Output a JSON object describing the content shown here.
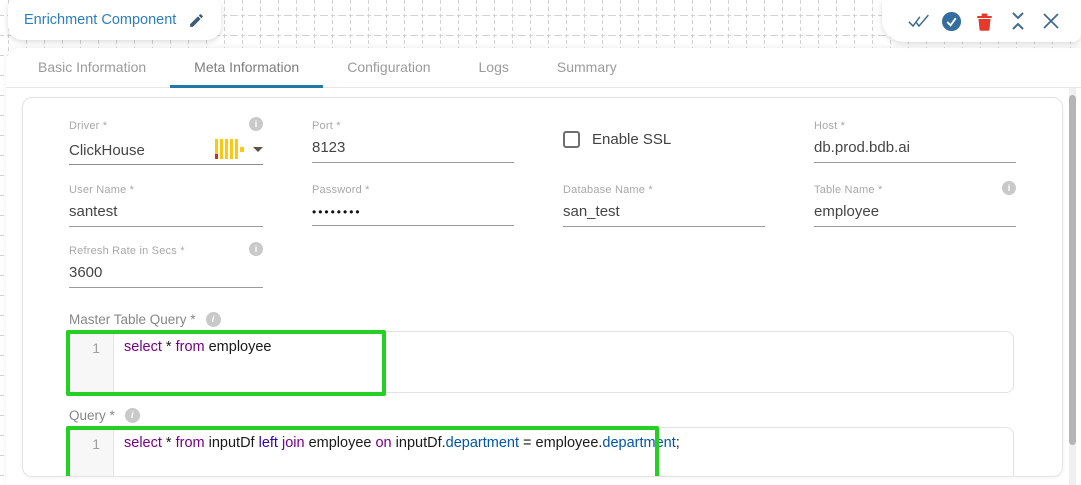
{
  "header": {
    "title": "Enrichment Component"
  },
  "toolbar": {
    "icons": [
      {
        "name": "validate-all-icon",
        "glyph": "double-checkmark",
        "color": "#3f6c91"
      },
      {
        "name": "apply-check-circle-icon",
        "glyph": "check-in-filled-circle",
        "color": "#336e9e"
      },
      {
        "name": "delete-trash-icon",
        "glyph": "trash-can",
        "color": "#e43a2c"
      },
      {
        "name": "collapse-vertical-icon",
        "glyph": "chevrons-toward-center",
        "color": "#3f6c91"
      },
      {
        "name": "close-icon",
        "glyph": "x-cross",
        "color": "#3f6c91"
      }
    ]
  },
  "tabs": [
    {
      "label": "Basic Information",
      "active": false
    },
    {
      "label": "Meta Information",
      "active": true
    },
    {
      "label": "Configuration",
      "active": false
    },
    {
      "label": "Logs",
      "active": false
    },
    {
      "label": "Summary",
      "active": false
    }
  ],
  "form": {
    "driver": {
      "label": "Driver *",
      "value": "ClickHouse",
      "icon": "clickhouse-logo",
      "has_info": true,
      "has_dropdown": true
    },
    "port": {
      "label": "Port *",
      "value": "8123"
    },
    "enable_ssl": {
      "label": "Enable SSL",
      "checked": false
    },
    "host": {
      "label": "Host *",
      "value": "db.prod.bdb.ai"
    },
    "user_name": {
      "label": "User Name *",
      "value": "santest"
    },
    "password": {
      "label": "Password *",
      "value": "••••••••"
    },
    "database_name": {
      "label": "Database Name *",
      "value": "san_test"
    },
    "table_name": {
      "label": "Table Name *",
      "value": "employee",
      "has_info": true
    },
    "refresh_rate": {
      "label": "Refresh Rate in Secs *",
      "value": "3600",
      "has_info": true
    }
  },
  "master_table_query": {
    "label": "Master Table Query *",
    "line_number": "1",
    "text": "select * from employee",
    "tokens": [
      {
        "t": "select",
        "c": "kw"
      },
      {
        "t": " * ",
        "c": "pl"
      },
      {
        "t": "from",
        "c": "kw"
      },
      {
        "t": " employee",
        "c": "pl"
      }
    ]
  },
  "query": {
    "label": "Query *",
    "line_number": "1",
    "text": "select * from inputDf left join employee on inputDf.department = employee.department;",
    "tokens": [
      {
        "t": "select",
        "c": "kw"
      },
      {
        "t": " * ",
        "c": "pl"
      },
      {
        "t": "from",
        "c": "kw"
      },
      {
        "t": " inputDf ",
        "c": "pl"
      },
      {
        "t": "left",
        "c": "bi"
      },
      {
        "t": " ",
        "c": "pl"
      },
      {
        "t": "join",
        "c": "kw"
      },
      {
        "t": " employee ",
        "c": "pl"
      },
      {
        "t": "on",
        "c": "kw"
      },
      {
        "t": " inputDf.",
        "c": "pl"
      },
      {
        "t": "department",
        "c": "v2"
      },
      {
        "t": " = employee.",
        "c": "pl"
      },
      {
        "t": "department",
        "c": "v2"
      },
      {
        "t": ";",
        "c": "pl"
      }
    ]
  },
  "colors": {
    "accent_blue": "#2b7fc0",
    "tab_underline": "#2179a8",
    "highlight_green": "#25d025",
    "trash_red": "#e43a2c",
    "clickhouse_yellow": "#fbc912",
    "clickhouse_red": "#e0241c",
    "sql_keyword": "#770088",
    "sql_builtin": "#3300aa",
    "sql_field": "#0055aa"
  }
}
